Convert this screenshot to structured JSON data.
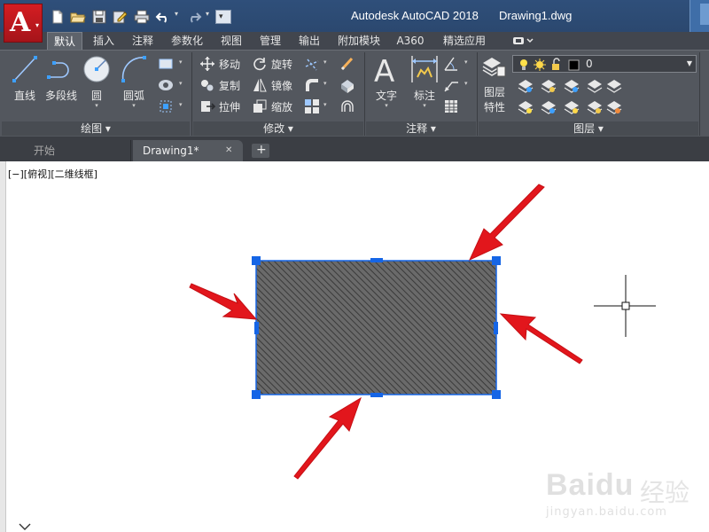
{
  "titlebar": {
    "app_name": "Autodesk AutoCAD 2018",
    "doc_name": "Drawing1.dwg",
    "logo_letter": "A",
    "quick_access": [
      "new-icon",
      "open-icon",
      "save-icon",
      "save-as-icon",
      "print-icon",
      "undo-icon",
      "redo-icon"
    ]
  },
  "ribbon_tabs": [
    "默认",
    "插入",
    "注释",
    "参数化",
    "视图",
    "管理",
    "输出",
    "附加模块",
    "A360",
    "精选应用"
  ],
  "active_tab": "默认",
  "panels": {
    "draw": {
      "title": "绘图",
      "line": "直线",
      "polyline": "多段线",
      "circle": "圆",
      "arc": "圆弧"
    },
    "modify": {
      "title": "修改",
      "move": "移动",
      "rotate": "旋转",
      "copy": "复制",
      "mirror": "镜像",
      "stretch": "拉伸",
      "scale": "缩放"
    },
    "annotation": {
      "title": "注释",
      "text": "文字",
      "dimension": "标注"
    },
    "layers": {
      "title": "图层",
      "properties_line1": "图层",
      "properties_line2": "特性",
      "current_layer": "0"
    }
  },
  "file_tabs": {
    "start": "开始",
    "drawing": "Drawing1*",
    "close": "✕",
    "add": "+"
  },
  "viewport_label": "[−][俯视][二维线框]",
  "watermark": {
    "brand": "Baidu",
    "cn": "经验",
    "url": "jingyan.baidu.com"
  },
  "colors": {
    "titlebar": "#2f4f7a",
    "ribbon": "#53575e",
    "selection_grip": "#1565e6",
    "hatch": "#555555",
    "arrow": "#e2161c"
  }
}
